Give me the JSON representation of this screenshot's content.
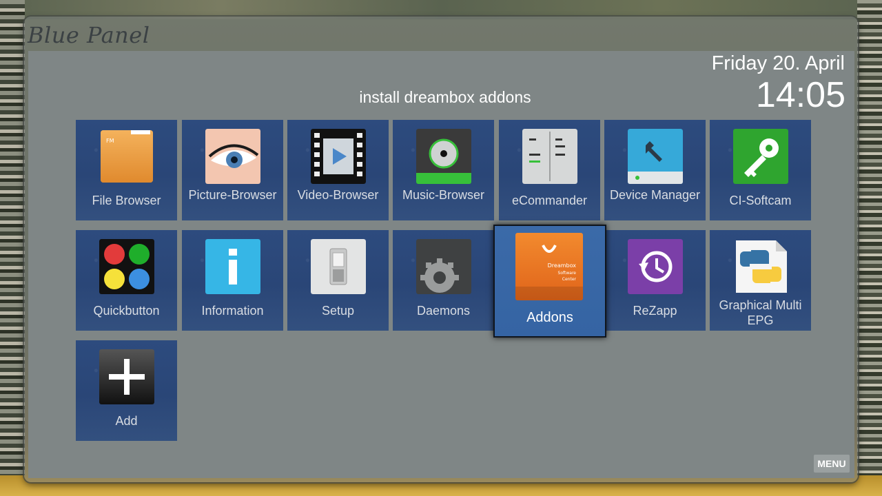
{
  "panel": {
    "title": "Blue Panel",
    "subtitle": "install dreambox addons",
    "date": "Friday 20. April",
    "time": "14:05",
    "menu_label": "MENU"
  },
  "tiles": [
    {
      "label": "File Browser",
      "icon": "folder-icon"
    },
    {
      "label": "Picture-Browser",
      "icon": "eye-icon"
    },
    {
      "label": "Video-Browser",
      "icon": "film-icon"
    },
    {
      "label": "Music-Browser",
      "icon": "disc-icon"
    },
    {
      "label": "eCommander",
      "icon": "server-icon"
    },
    {
      "label": "Device Manager",
      "icon": "wrench-drive-icon"
    },
    {
      "label": "CI-Softcam",
      "icon": "key-icon"
    },
    {
      "label": "Quickbutton",
      "icon": "color-buttons-icon"
    },
    {
      "label": "Information",
      "icon": "info-icon"
    },
    {
      "label": "Setup",
      "icon": "switch-icon"
    },
    {
      "label": "Daemons",
      "icon": "gear-icon"
    },
    {
      "label": "Addons",
      "icon": "shopping-bag-icon",
      "icon_text": [
        "Dreambox",
        "Software",
        "Center"
      ],
      "selected": true
    },
    {
      "label": "ReZapp",
      "icon": "history-icon"
    },
    {
      "label": "Graphical Multi EPG",
      "icon": "python-icon"
    },
    {
      "label": "Add",
      "icon": "plus-icon"
    }
  ],
  "colors": {
    "tile_bg": "#2d4b7e",
    "selected_bg": "#3b6aa8",
    "panel_bg": "#7f8686"
  }
}
